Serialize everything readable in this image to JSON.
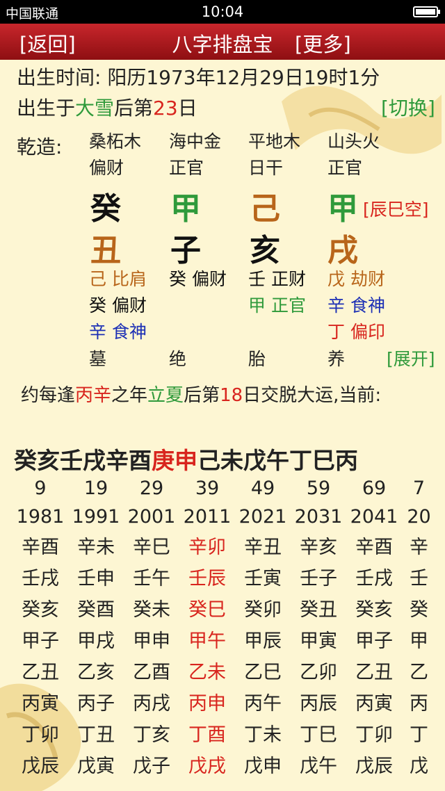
{
  "status": {
    "carrier": "中国联通",
    "time": "10:04"
  },
  "header": {
    "back": "[返回]",
    "title": "八字排盘宝",
    "more": "[更多]"
  },
  "birth": {
    "time_label": "出生时间: 阳历1973年12月29日19时1分",
    "after_prefix": "出生于",
    "term": "大雪",
    "after_mid": "后第",
    "days": "23",
    "after_suffix": "日",
    "switch": "[切换]"
  },
  "chart": {
    "label": "乾造:",
    "nayin": [
      "桑柘木",
      "海中金",
      "平地木",
      "山头火"
    ],
    "shishen": [
      "偏财",
      "正官",
      "日干",
      "正官"
    ],
    "stems": [
      "癸",
      "甲",
      "己",
      "甲"
    ],
    "kong": "[辰巳空]",
    "branches": [
      "丑",
      "子",
      "亥",
      "戌"
    ],
    "hidden": [
      [
        "己 比肩",
        "癸 偏财",
        "壬 正财",
        "戊 劫财"
      ],
      [
        "癸 偏财",
        "",
        "甲 正官",
        "辛 食神"
      ],
      [
        "辛 食神",
        "",
        "",
        "丁 偏印"
      ]
    ],
    "state": [
      "墓",
      "绝",
      "胎",
      "养"
    ],
    "expand": "[展开]"
  },
  "dayun": {
    "p1": "约每逢",
    "stems": "丙辛",
    "p2": "之年",
    "term": "立夏",
    "p3": "后第",
    "days": "18",
    "p4": "日交脱大运,当前:",
    "seq_a": "癸亥壬戌辛酉",
    "seq_cur": "庚申",
    "seq_b": "己未戊午丁巳丙",
    "ages": [
      "9",
      "19",
      "29",
      "39",
      "49",
      "59",
      "69",
      "7"
    ],
    "years": [
      "1981",
      "1991",
      "2001",
      "2011",
      "2021",
      "2031",
      "2041",
      "20"
    ],
    "rows": [
      [
        "辛酉",
        "辛未",
        "辛巳",
        "辛卯",
        "辛丑",
        "辛亥",
        "辛酉",
        "辛"
      ],
      [
        "壬戌",
        "壬申",
        "壬午",
        "壬辰",
        "壬寅",
        "壬子",
        "壬戌",
        "壬"
      ],
      [
        "癸亥",
        "癸酉",
        "癸未",
        "癸巳",
        "癸卯",
        "癸丑",
        "癸亥",
        "癸"
      ],
      [
        "甲子",
        "甲戌",
        "甲申",
        "甲午",
        "甲辰",
        "甲寅",
        "甲子",
        "甲"
      ],
      [
        "乙丑",
        "乙亥",
        "乙酉",
        "乙未",
        "乙巳",
        "乙卯",
        "乙丑",
        "乙"
      ],
      [
        "丙寅",
        "丙子",
        "丙戌",
        "丙申",
        "丙午",
        "丙辰",
        "丙寅",
        "丙"
      ],
      [
        "丁卯",
        "丁丑",
        "丁亥",
        "丁酉",
        "丁未",
        "丁巳",
        "丁卯",
        "丁"
      ],
      [
        "戊辰",
        "戊寅",
        "戊子",
        "戊戌",
        "戊申",
        "戊午",
        "戊辰",
        "戊"
      ]
    ]
  },
  "colors": {
    "title_bar": "#b51c20",
    "green": "#2f9a3b",
    "red": "#d8251e",
    "brown": "#b8651a",
    "blue": "#1c2fb5",
    "background": "#fdf6d3"
  }
}
